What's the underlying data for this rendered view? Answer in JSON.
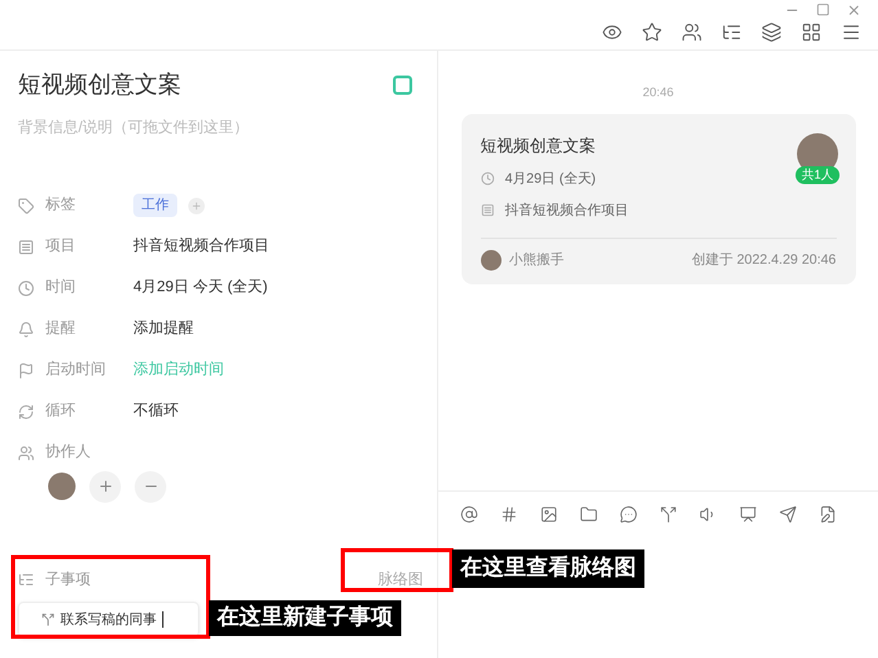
{
  "task": {
    "title": "短视频创意文案",
    "completed": false,
    "description_placeholder": "背景信息/说明（可拖文件到这里）"
  },
  "fields": [
    {
      "kind": "tags",
      "label": "标签",
      "tags": [
        "工作"
      ]
    },
    {
      "kind": "text",
      "label": "项目",
      "value": "抖音短视频合作项目"
    },
    {
      "kind": "text",
      "label": "时间",
      "value": "4月29日 今天 (全天)"
    },
    {
      "kind": "text",
      "label": "提醒",
      "value": "添加提醒"
    },
    {
      "kind": "action",
      "label": "启动时间",
      "value": "添加启动时间"
    },
    {
      "kind": "text",
      "label": "循环",
      "value": "不循环"
    },
    {
      "kind": "people",
      "label": "协作人"
    }
  ],
  "subtasks": {
    "label": "子事项",
    "input_value": "联系写稿的同事"
  },
  "graph_button": "脉络图",
  "feed": {
    "time": "20:46",
    "card": {
      "title": "短视频创意文案",
      "date": "4月29日 (全天)",
      "project": "抖音短视频合作项目",
      "member_badge": "共1人",
      "author": "小熊搬手",
      "created": "创建于 2022.4.29 20:46"
    }
  },
  "annotations": [
    {
      "text": "在这里新建子事项"
    },
    {
      "text": "在这里查看脉络图"
    }
  ]
}
